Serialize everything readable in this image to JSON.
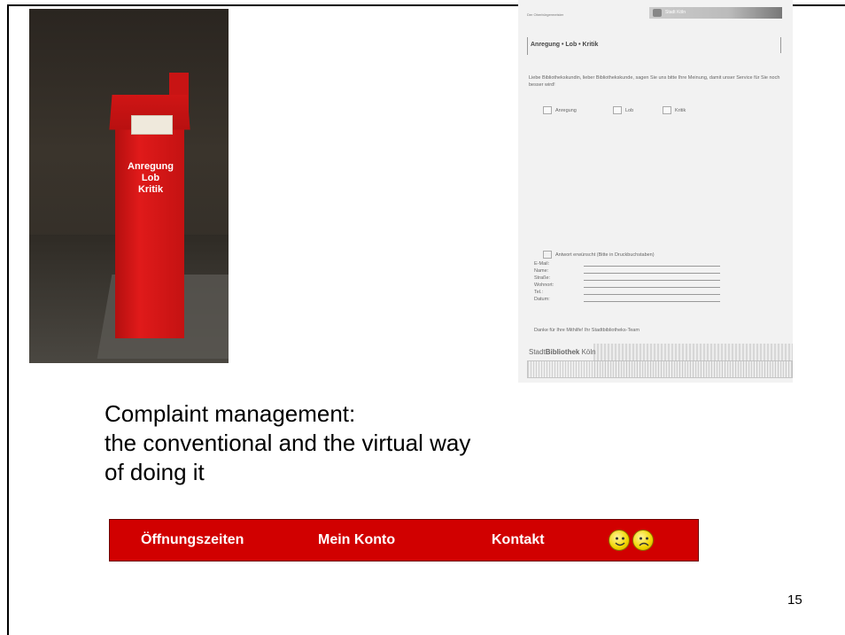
{
  "photo": {
    "stand_lines": [
      "Anregung",
      "Lob",
      "Kritik"
    ]
  },
  "form": {
    "header_left": "Der Oberbürgermeister",
    "header_logo": "Stadt Köln",
    "title": "Anregung • Lob • Kritik",
    "intro": "Liebe Bibliothekskundin, lieber Bibliothekskunde, sagen Sie uns bitte Ihre Meinung, damit unser Service für Sie noch besser wird!",
    "checkboxes": [
      "Anregung",
      "Lob",
      "Kritik"
    ],
    "answer_label": "Antwort erwünscht (Bitte in Druckbuchstaben)",
    "fields": [
      "E-Mail:",
      "Name:",
      "Straße:",
      "Wohnort:",
      "Tel.:",
      "Datum:"
    ],
    "thanks": "Danke für Ihre Mithilfe! Ihr Stadtbibliotheks-Team",
    "brand_prefix": "Stadt",
    "brand_bold": "Bibliothek",
    "brand_suffix": " Köln"
  },
  "caption": {
    "lines": [
      "Complaint management:",
      "the conventional and the virtual way",
      "of doing it"
    ]
  },
  "navbar": {
    "items": [
      "Öffnungszeiten",
      "Mein Konto",
      "Kontakt"
    ],
    "smileys": [
      "happy-smiley-icon",
      "sad-smiley-icon"
    ],
    "bg_color": "#d10000"
  },
  "page_number": "15"
}
